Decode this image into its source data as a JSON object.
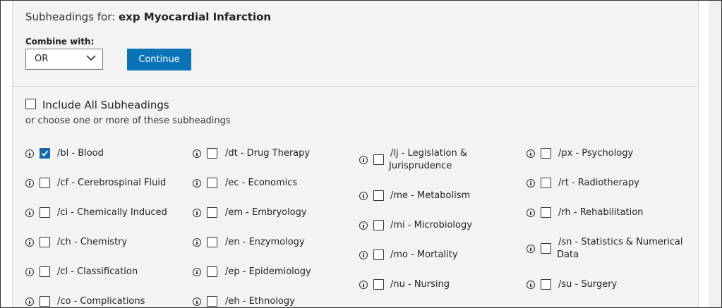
{
  "header": {
    "prefix": "Subheadings for:",
    "term": "exp Myocardial Infarction"
  },
  "combine": {
    "label": "Combine with:",
    "selected": "OR",
    "continue_label": "Continue"
  },
  "include_all": {
    "label": "Include All Subheadings",
    "checked": false
  },
  "choose_text": "or choose one or more of these subheadings",
  "columns": [
    [
      {
        "label": "/bl - Blood",
        "checked": true
      },
      {
        "label": "/cf - Cerebrospinal Fluid",
        "checked": false
      },
      {
        "label": "/ci - Chemically Induced",
        "checked": false
      },
      {
        "label": "/ch - Chemistry",
        "checked": false
      },
      {
        "label": "/cl - Classification",
        "checked": false
      },
      {
        "label": "/co - Complications",
        "checked": false
      }
    ],
    [
      {
        "label": "/dt - Drug Therapy",
        "checked": false
      },
      {
        "label": "/ec - Economics",
        "checked": false
      },
      {
        "label": "/em - Embryology",
        "checked": false
      },
      {
        "label": "/en - Enzymology",
        "checked": false
      },
      {
        "label": "/ep - Epidemiology",
        "checked": false
      },
      {
        "label": "/eh - Ethnology",
        "checked": false
      }
    ],
    [
      {
        "label_line1": "/lj - Legislation &",
        "label_line2": "Jurisprudence",
        "checked": false
      },
      {
        "label": "/me - Metabolism",
        "checked": false
      },
      {
        "label": "/mi - Microbiology",
        "checked": false
      },
      {
        "label": "/mo - Mortality",
        "checked": false
      },
      {
        "label": "/nu - Nursing",
        "checked": false
      }
    ],
    [
      {
        "label": "/px - Psychology",
        "checked": false
      },
      {
        "label": "/rt - Radiotherapy",
        "checked": false
      },
      {
        "label": "/rh - Rehabilitation",
        "checked": false
      },
      {
        "label_line1": "/sn - Statistics & Numerical",
        "label_line2": "Data",
        "checked": false
      },
      {
        "label": "/su - Surgery",
        "checked": false
      }
    ]
  ],
  "icons": {
    "info": "info-circle-icon",
    "check": "checkmark-icon",
    "chevron": "chevron-down-icon"
  },
  "colors": {
    "primary_button": "#0a73b8",
    "checkbox_checked": "#1669a8",
    "panel_background": "#f3f3f3"
  }
}
